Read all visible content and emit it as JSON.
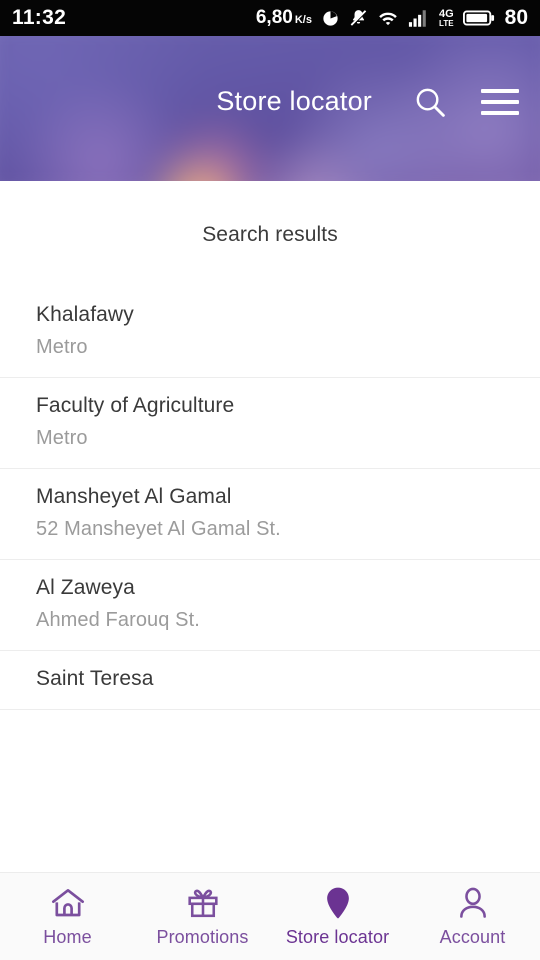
{
  "statusbar": {
    "time": "11:32",
    "net_speed_value": "6,80",
    "net_speed_unit": "K/s",
    "alarm_icon": "alarm-icon",
    "mute_icon": "bell-muted-icon",
    "wifi_icon": "wifi-icon",
    "signal_icon": "signal-bars-icon",
    "network_type": "4G",
    "network_sub": "LTE",
    "battery_icon": "battery-icon",
    "battery_level": "80"
  },
  "header": {
    "title": "Store locator",
    "search_icon": "search-icon",
    "menu_icon": "hamburger-menu-icon"
  },
  "main": {
    "section_title": "Search results",
    "results": [
      {
        "name": "Khalafawy",
        "subtitle": "Metro"
      },
      {
        "name": "Faculty of Agriculture",
        "subtitle": "Metro"
      },
      {
        "name": "Mansheyet Al Gamal",
        "subtitle": "52 Mansheyet Al Gamal St."
      },
      {
        "name": "Al Zaweya",
        "subtitle": "Ahmed Farouq St."
      },
      {
        "name": "Saint Teresa",
        "subtitle": ""
      }
    ]
  },
  "bottom_nav": {
    "items": [
      {
        "label": "Home",
        "icon": "home-icon",
        "active": false
      },
      {
        "label": "Promotions",
        "icon": "gift-icon",
        "active": false
      },
      {
        "label": "Store locator",
        "icon": "map-pin-icon",
        "active": true
      },
      {
        "label": "Account",
        "icon": "person-icon",
        "active": false
      }
    ]
  },
  "colors": {
    "brand_purple": "#6b3392",
    "nav_purple": "#7b4f9e",
    "header_purple": "#6359a8",
    "divider": "#ededed"
  }
}
